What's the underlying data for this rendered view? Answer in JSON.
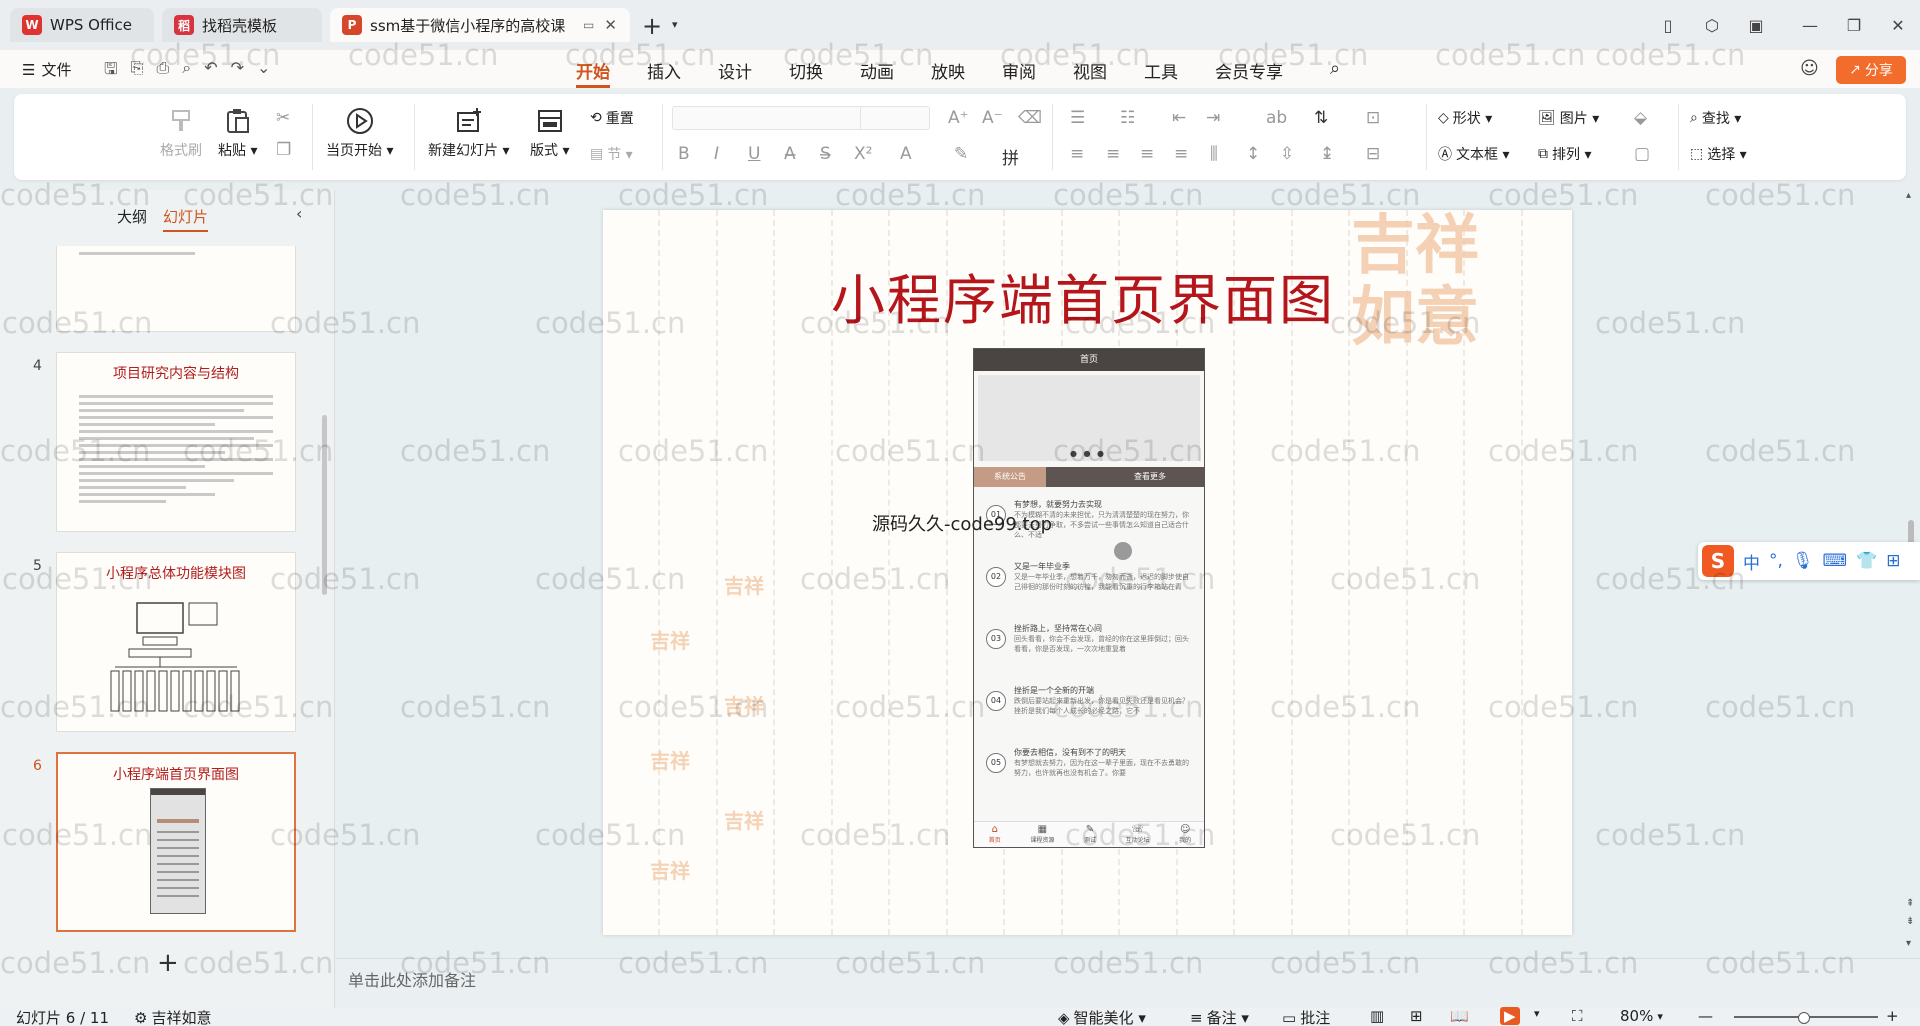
{
  "tabs": [
    {
      "label": "WPS Office",
      "logo": "W",
      "logo_color": "#e0322f"
    },
    {
      "label": "找稻壳模板",
      "logo": "稻",
      "logo_color": "#d8343f"
    },
    {
      "label": "ssm基于微信小程序的高校课",
      "logo": "P",
      "logo_color": "#d5462b"
    }
  ],
  "menubar": {
    "file_label": "文件",
    "menus": [
      "开始",
      "插入",
      "设计",
      "切换",
      "动画",
      "放映",
      "审阅",
      "视图",
      "工具",
      "会员专享"
    ],
    "active_menu": "开始",
    "share_label": "分享"
  },
  "ribbon": {
    "format_painter": "格式刷",
    "paste": "粘贴",
    "start_from_current": "当页开始",
    "new_slide": "新建幻灯片",
    "layout": "版式",
    "reset": "重置",
    "section": "节",
    "shape": "形状",
    "picture": "图片",
    "textbox": "文本框",
    "arrange": "排列",
    "find": "查找",
    "select": "选择"
  },
  "left_panel": {
    "tab_outline": "大纲",
    "tab_slides": "幻灯片",
    "slides": [
      {
        "number": "4",
        "title": "项目研究内容与结构"
      },
      {
        "number": "5",
        "title": "小程序总体功能模块图"
      },
      {
        "number": "6",
        "title": "小程序端首页界面图"
      }
    ]
  },
  "slide": {
    "title": "小程序端首页界面图",
    "phone": {
      "header": "首页",
      "section_left": "系统公告",
      "section_right": "查看更多",
      "items": [
        {
          "num": "01",
          "title": "有梦想，就要努力去实现",
          "desc": "不为模糊不清的未来担忧，只为清清楚楚的现在努力，你都要去努力争取，不多尝试一些事情怎么知道自己适合什么、不适"
        },
        {
          "num": "02",
          "title": "又是一年毕业季",
          "desc": "又是一年毕业季，想着万千，匆匆而逝，迟迟的脚步使自己徘徊的那份时刻的彷徨，我能看沉重的行李箱站在青"
        },
        {
          "num": "03",
          "title": "挫折路上，坚持常在心间",
          "desc": "回头看看，你会不会发现，曾经的你在这里摔倒过；回头看看，你是否发现，一次次地重复着"
        },
        {
          "num": "04",
          "title": "挫折是一个全新的开端",
          "desc": "跌倒后要站起来重新出发，你是看见失败还是看见机会？挫折是我们每个人成长的必经之路，它不"
        },
        {
          "num": "05",
          "title": "你要去相信，没有到不了的明天",
          "desc": "有梦想就去努力，因为在这一辈子里面，现在不去勇敢的努力，也许就再也没有机会了。你要"
        }
      ],
      "nav": [
        "首页",
        "课程资源",
        "测试",
        "互动论坛",
        "我的"
      ]
    },
    "overlay_text": "源码久久-code99.top"
  },
  "notes_placeholder": "单击此处添加备注",
  "ime": {
    "lang": "中"
  },
  "statusbar": {
    "slide_counter": "幻灯片 6 / 11",
    "theme": "吉祥如意",
    "beautify": "智能美化",
    "notes": "备注",
    "comments": "批注",
    "zoom": "80%"
  },
  "watermark": "code51.cn"
}
